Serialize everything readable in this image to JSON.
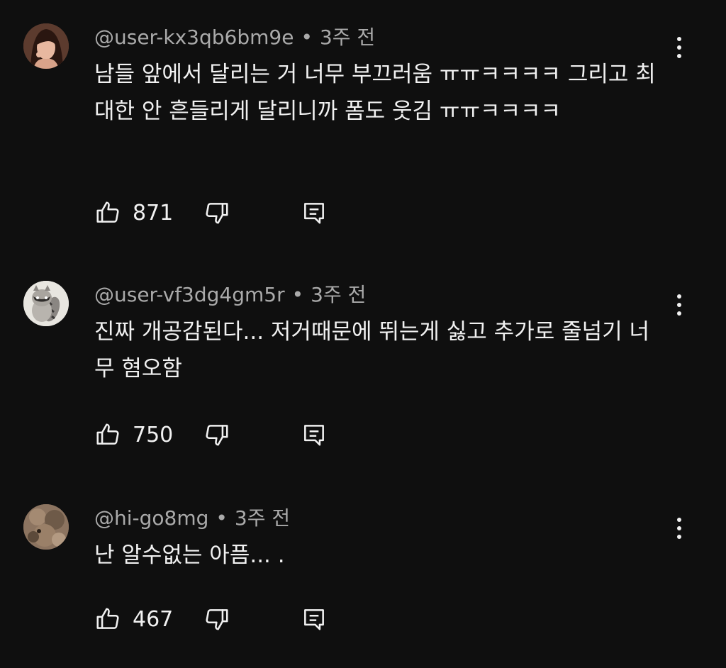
{
  "comments": [
    {
      "author": "@user-kx3qb6bm9e",
      "time": "3주 전",
      "text": "남들 앞에서 달리는 거 너무 부끄러움 ㅠㅠㅋㅋㅋㅋ 그리고 최대한 안 흔들리게 달리니까 폼도 웃김 ㅠㅠㅋㅋㅋㅋ",
      "likes": "871"
    },
    {
      "author": "@user-vf3dg4gm5r",
      "time": "3주 전",
      "text": "진짜 개공감된다... 저거때문에 뛰는게 싫고 추가로 줄넘기 너무 혐오함",
      "likes": "750"
    },
    {
      "author": "@hi-go8mg",
      "time": "3주 전",
      "text": "난 알수없는 아픔... .",
      "likes": "467"
    }
  ],
  "icons": {
    "like": "thumb-up-icon",
    "dislike": "thumb-down-icon",
    "reply": "reply-comment-icon",
    "more": "more-vertical-icon"
  },
  "colors": {
    "background": "#0f0f0f",
    "text": "#f1f1f1",
    "meta": "#aaaaaa"
  }
}
